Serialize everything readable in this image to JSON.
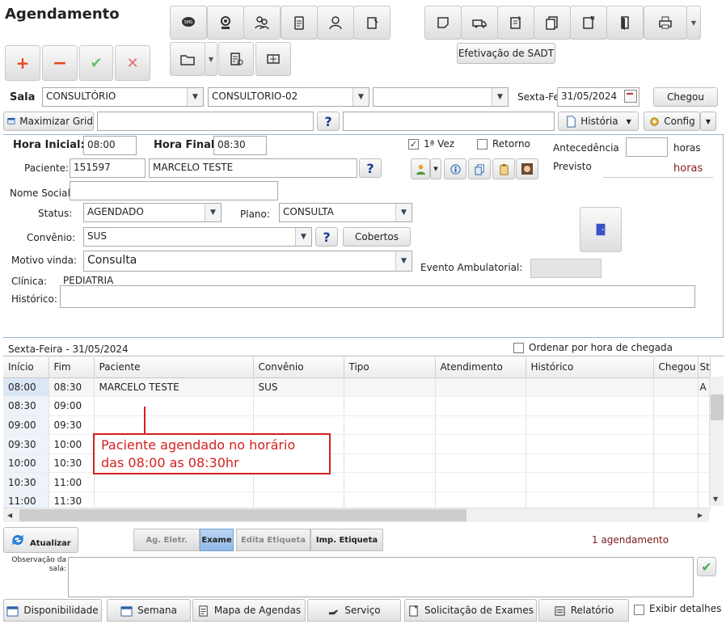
{
  "app": {
    "title": "Agendamento"
  },
  "toolbar": {
    "efetivacao_label": "Efetivação de SADT"
  },
  "sala_row": {
    "sala_label": "Sala",
    "sala_value": "CONSULTÓRIO",
    "consultorio_value": "CONSULTORIO-02",
    "third_value": "",
    "day_label": "Sexta-Fei",
    "date_value": "31/05/2024",
    "chegou_label": "Chegou"
  },
  "grid_row": {
    "maximizar_label": "Maximizar Grid",
    "help_label": "?",
    "historia_label": "História",
    "config_label": "Config"
  },
  "form": {
    "hora_inicial_label": "Hora Inicial:",
    "hora_inicial_value": "08:00",
    "hora_final_label": "Hora Final:",
    "hora_final_value": "08:30",
    "primeira_vez_label": "1ª Vez",
    "retorno_label": "Retorno",
    "antecedencia_label": "Antecedência",
    "horas_label": "horas",
    "previsto_label": "Previsto",
    "previsto_value": "horas",
    "paciente_label": "Paciente:",
    "paciente_id": "151597",
    "paciente_nome": "MARCELO TESTE",
    "nome_social_label": "Nome Social:",
    "status_label": "Status:",
    "status_value": "AGENDADO",
    "plano_label": "Plano:",
    "plano_value": "CONSULTA",
    "convenio_label": "Convênio:",
    "convenio_value": "SUS",
    "cobertos_label": "Cobertos",
    "motivo_label": "Motivo vinda:",
    "motivo_value": "Consulta",
    "evento_label": "Evento Ambulatorial:",
    "clinica_label": "Clínica:",
    "clinica_value": "PEDIATRIA",
    "historico_label": "Histórico:"
  },
  "schedule": {
    "date_title": "Sexta-Feira - 31/05/2024",
    "ordenar_label": "Ordenar por hora de chegada",
    "columns": [
      "Início",
      "Fim",
      "Paciente",
      "Convênio",
      "Tipo",
      "Atendimento",
      "Histórico",
      "Chegou",
      "Stat"
    ],
    "rows": [
      [
        "08:00",
        "08:30",
        "MARCELO TESTE",
        "SUS",
        "",
        "",
        "",
        "",
        "A"
      ],
      [
        "08:30",
        "09:00",
        "",
        "",
        "",
        "",
        "",
        "",
        ""
      ],
      [
        "09:00",
        "09:30",
        "",
        "",
        "",
        "",
        "",
        "",
        ""
      ],
      [
        "09:30",
        "10:00",
        "",
        "",
        "",
        "",
        "",
        "",
        ""
      ],
      [
        "10:00",
        "10:30",
        "",
        "",
        "",
        "",
        "",
        "",
        ""
      ],
      [
        "10:30",
        "11:00",
        "",
        "",
        "",
        "",
        "",
        "",
        ""
      ],
      [
        "11:00",
        "11:30",
        "",
        "",
        "",
        "",
        "",
        "",
        ""
      ]
    ],
    "annotation_line1": "Paciente agendado no horário",
    "annotation_line2": "das 08:00 as 08:30hr"
  },
  "actions": {
    "atualizar_label": "Atualizar",
    "ag_eletr_label": "Ag. Eletr.",
    "exame_label": "Exame",
    "edita_etiqueta_label": "Edita Etiqueta",
    "imp_etiqueta_label": "Imp. Etiqueta",
    "count_text": "1 agendamento",
    "observacao_label": "Observação da sala:"
  },
  "tabs": {
    "disponibilidade": "Disponibilidade",
    "semana": "Semana",
    "mapa": "Mapa de Agendas",
    "servico": "Serviço",
    "solicitacao": "Solicitação de Exames",
    "relatorio": "Relatório",
    "exibir_detalhes": "Exibir detalhes"
  },
  "colors": {
    "annotation_red": "#d42020",
    "accent_blue": "#1a3c8f",
    "add_orange": "#e8461f",
    "ok_green": "#4caf50"
  }
}
